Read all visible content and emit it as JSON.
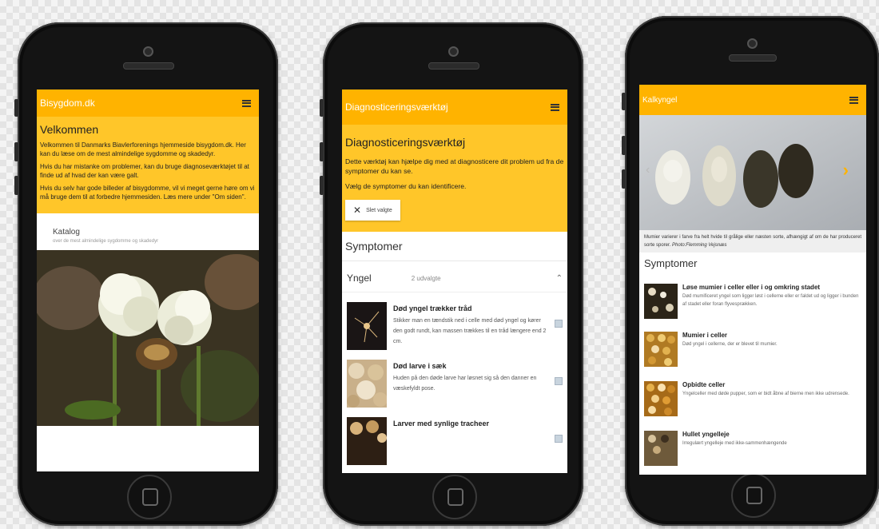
{
  "colors": {
    "accent": "#ffb300",
    "panel": "#ffc629"
  },
  "phone1": {
    "title": "Bisygdom.dk",
    "menu_icon": "hamburger-menu-icon",
    "heading": "Velkommen",
    "p1": "Velkommen til Danmarks Biavlerforenings hjemmeside bisygdom.dk. Her kan du læse om de mest almindelige sygdomme og skadedyr.",
    "p2": "Hvis du har mistanke om problemer, kan du bruge diagnoseværktøjet til at finde ud af hvad der kan være galt.",
    "p3": "Hvis du selv har gode billeder af bisygdomme, vil vi meget gerne høre om vi må bruge dem til at forbedre hjemmesiden. Læs mere under \"Om siden\".",
    "catalog_title": "Katalog",
    "catalog_sub": "over de mest almindelige sygdomme og skadedyr"
  },
  "phone2": {
    "title": "Diagnosticeringsværktøj",
    "menu_icon": "hamburger-menu-icon",
    "heading": "Diagnosticeringsværktøj",
    "p1": "Dette værktøj kan hjælpe dig med at diagnosticere dit problem ud fra de symptomer du kan se.",
    "p2": "Vælg de symptomer du kan identificere.",
    "clear_label": "Slet valgte",
    "section_title": "Symptomer",
    "group_label": "Yngel",
    "group_count": "2 udvalgte",
    "items": [
      {
        "title": "Død yngel trækker tråd",
        "desc": "Stikker man en tændstik ned i celle med død yngel og kører den godt rundt, kan massen trækkes til en tråd længere end 2 cm."
      },
      {
        "title": "Død larve i sæk",
        "desc": "Huden på den døde larve har løsnet sig så den danner en væskefyldt pose."
      },
      {
        "title": "Larver med synlige tracheer",
        "desc": ""
      }
    ]
  },
  "phone3": {
    "title": "Kalkyngel",
    "menu_icon": "hamburger-menu-icon",
    "caption": "Mumier varierer i farve fra helt hvide til grålige eller næsten sorte, afhængigt af om de har produceret sorte sporer.",
    "caption_credit": "Photo:Flemming Vejsnæs",
    "section_title": "Symptomer",
    "items": [
      {
        "title": "Løse mumier i celler eller i og omkring stadet",
        "desc": "Død mumificeret yngel som ligger løst i cellerne eller er faldet ud og ligger i bunden af stadet eller foran flyvesprækken."
      },
      {
        "title": "Mumier i celler",
        "desc": "Død yngel i cellerne, der er blevet til mumier."
      },
      {
        "title": "Opbidte celler",
        "desc": "Yngelceller med døde pupper, som er bidt åbne af bierne men ikke udrensede."
      },
      {
        "title": "Hullet yngelleje",
        "desc": "Irregulært yngelleje med ikke-sammenhængende"
      }
    ]
  }
}
